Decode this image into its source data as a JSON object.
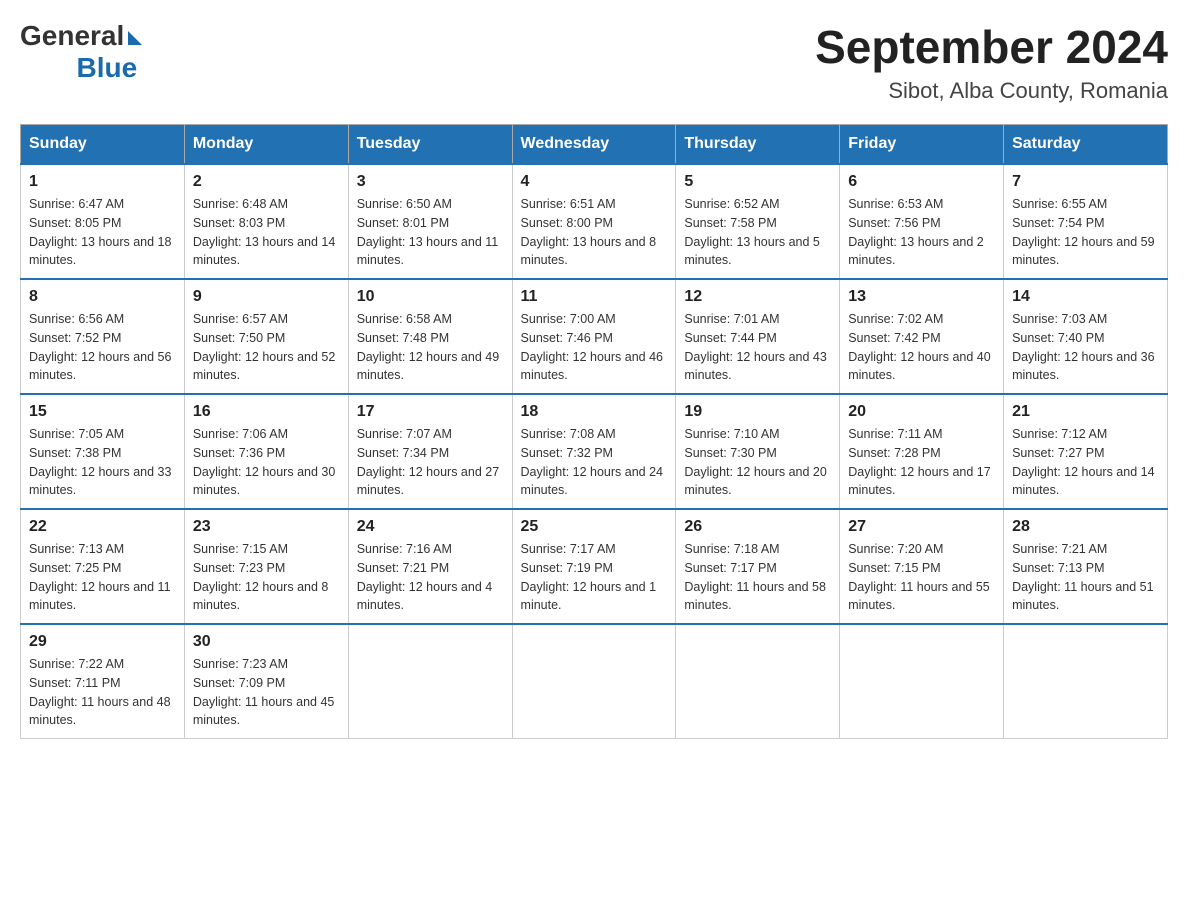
{
  "logo": {
    "general": "General",
    "blue": "Blue"
  },
  "title": "September 2024",
  "subtitle": "Sibot, Alba County, Romania",
  "days_of_week": [
    "Sunday",
    "Monday",
    "Tuesday",
    "Wednesday",
    "Thursday",
    "Friday",
    "Saturday"
  ],
  "weeks": [
    [
      {
        "day": "1",
        "sunrise": "Sunrise: 6:47 AM",
        "sunset": "Sunset: 8:05 PM",
        "daylight": "Daylight: 13 hours and 18 minutes."
      },
      {
        "day": "2",
        "sunrise": "Sunrise: 6:48 AM",
        "sunset": "Sunset: 8:03 PM",
        "daylight": "Daylight: 13 hours and 14 minutes."
      },
      {
        "day": "3",
        "sunrise": "Sunrise: 6:50 AM",
        "sunset": "Sunset: 8:01 PM",
        "daylight": "Daylight: 13 hours and 11 minutes."
      },
      {
        "day": "4",
        "sunrise": "Sunrise: 6:51 AM",
        "sunset": "Sunset: 8:00 PM",
        "daylight": "Daylight: 13 hours and 8 minutes."
      },
      {
        "day": "5",
        "sunrise": "Sunrise: 6:52 AM",
        "sunset": "Sunset: 7:58 PM",
        "daylight": "Daylight: 13 hours and 5 minutes."
      },
      {
        "day": "6",
        "sunrise": "Sunrise: 6:53 AM",
        "sunset": "Sunset: 7:56 PM",
        "daylight": "Daylight: 13 hours and 2 minutes."
      },
      {
        "day": "7",
        "sunrise": "Sunrise: 6:55 AM",
        "sunset": "Sunset: 7:54 PM",
        "daylight": "Daylight: 12 hours and 59 minutes."
      }
    ],
    [
      {
        "day": "8",
        "sunrise": "Sunrise: 6:56 AM",
        "sunset": "Sunset: 7:52 PM",
        "daylight": "Daylight: 12 hours and 56 minutes."
      },
      {
        "day": "9",
        "sunrise": "Sunrise: 6:57 AM",
        "sunset": "Sunset: 7:50 PM",
        "daylight": "Daylight: 12 hours and 52 minutes."
      },
      {
        "day": "10",
        "sunrise": "Sunrise: 6:58 AM",
        "sunset": "Sunset: 7:48 PM",
        "daylight": "Daylight: 12 hours and 49 minutes."
      },
      {
        "day": "11",
        "sunrise": "Sunrise: 7:00 AM",
        "sunset": "Sunset: 7:46 PM",
        "daylight": "Daylight: 12 hours and 46 minutes."
      },
      {
        "day": "12",
        "sunrise": "Sunrise: 7:01 AM",
        "sunset": "Sunset: 7:44 PM",
        "daylight": "Daylight: 12 hours and 43 minutes."
      },
      {
        "day": "13",
        "sunrise": "Sunrise: 7:02 AM",
        "sunset": "Sunset: 7:42 PM",
        "daylight": "Daylight: 12 hours and 40 minutes."
      },
      {
        "day": "14",
        "sunrise": "Sunrise: 7:03 AM",
        "sunset": "Sunset: 7:40 PM",
        "daylight": "Daylight: 12 hours and 36 minutes."
      }
    ],
    [
      {
        "day": "15",
        "sunrise": "Sunrise: 7:05 AM",
        "sunset": "Sunset: 7:38 PM",
        "daylight": "Daylight: 12 hours and 33 minutes."
      },
      {
        "day": "16",
        "sunrise": "Sunrise: 7:06 AM",
        "sunset": "Sunset: 7:36 PM",
        "daylight": "Daylight: 12 hours and 30 minutes."
      },
      {
        "day": "17",
        "sunrise": "Sunrise: 7:07 AM",
        "sunset": "Sunset: 7:34 PM",
        "daylight": "Daylight: 12 hours and 27 minutes."
      },
      {
        "day": "18",
        "sunrise": "Sunrise: 7:08 AM",
        "sunset": "Sunset: 7:32 PM",
        "daylight": "Daylight: 12 hours and 24 minutes."
      },
      {
        "day": "19",
        "sunrise": "Sunrise: 7:10 AM",
        "sunset": "Sunset: 7:30 PM",
        "daylight": "Daylight: 12 hours and 20 minutes."
      },
      {
        "day": "20",
        "sunrise": "Sunrise: 7:11 AM",
        "sunset": "Sunset: 7:28 PM",
        "daylight": "Daylight: 12 hours and 17 minutes."
      },
      {
        "day": "21",
        "sunrise": "Sunrise: 7:12 AM",
        "sunset": "Sunset: 7:27 PM",
        "daylight": "Daylight: 12 hours and 14 minutes."
      }
    ],
    [
      {
        "day": "22",
        "sunrise": "Sunrise: 7:13 AM",
        "sunset": "Sunset: 7:25 PM",
        "daylight": "Daylight: 12 hours and 11 minutes."
      },
      {
        "day": "23",
        "sunrise": "Sunrise: 7:15 AM",
        "sunset": "Sunset: 7:23 PM",
        "daylight": "Daylight: 12 hours and 8 minutes."
      },
      {
        "day": "24",
        "sunrise": "Sunrise: 7:16 AM",
        "sunset": "Sunset: 7:21 PM",
        "daylight": "Daylight: 12 hours and 4 minutes."
      },
      {
        "day": "25",
        "sunrise": "Sunrise: 7:17 AM",
        "sunset": "Sunset: 7:19 PM",
        "daylight": "Daylight: 12 hours and 1 minute."
      },
      {
        "day": "26",
        "sunrise": "Sunrise: 7:18 AM",
        "sunset": "Sunset: 7:17 PM",
        "daylight": "Daylight: 11 hours and 58 minutes."
      },
      {
        "day": "27",
        "sunrise": "Sunrise: 7:20 AM",
        "sunset": "Sunset: 7:15 PM",
        "daylight": "Daylight: 11 hours and 55 minutes."
      },
      {
        "day": "28",
        "sunrise": "Sunrise: 7:21 AM",
        "sunset": "Sunset: 7:13 PM",
        "daylight": "Daylight: 11 hours and 51 minutes."
      }
    ],
    [
      {
        "day": "29",
        "sunrise": "Sunrise: 7:22 AM",
        "sunset": "Sunset: 7:11 PM",
        "daylight": "Daylight: 11 hours and 48 minutes."
      },
      {
        "day": "30",
        "sunrise": "Sunrise: 7:23 AM",
        "sunset": "Sunset: 7:09 PM",
        "daylight": "Daylight: 11 hours and 45 minutes."
      },
      null,
      null,
      null,
      null,
      null
    ]
  ]
}
